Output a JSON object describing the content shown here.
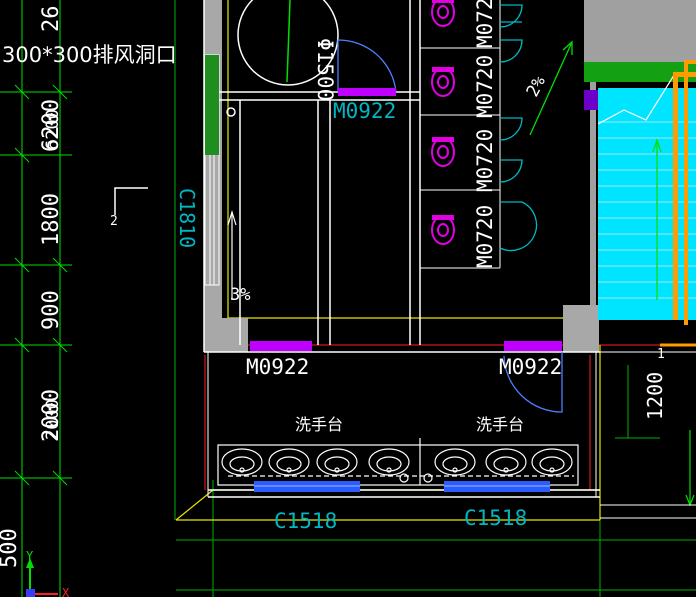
{
  "colors": {
    "background": "#000000",
    "wall_white": "#ffffff",
    "wall_gray": "#a8a8a8",
    "dim_green": "#00e000",
    "window_cyan": "#00b7c3",
    "door_purple": "#c000ff",
    "fixture_magenta": "#e000e0",
    "fixture_blue": "#4d7fff",
    "outline_yellow": "#e8e800",
    "axis_red": "#ff2020",
    "stair_fill": "#00e5ff",
    "rail_orange": "#ff9a00"
  },
  "dimensions_left": [
    "26",
    "6200",
    "1800",
    "900",
    "2000",
    "500"
  ],
  "dimension_overlay_left": [
    "6200",
    "2000"
  ],
  "dimension_right": "1200",
  "vent_note": "300*300排风洞口",
  "window_labels": [
    "C1810",
    "C1518",
    "C1518"
  ],
  "door_labels": [
    "M0922",
    "M0922",
    "M0922"
  ],
  "partition_labels": [
    "M0720",
    "M0720",
    "M0720",
    "M0720"
  ],
  "pipe_label": "Φ1500",
  "slope_labels": [
    "3%",
    "2%"
  ],
  "basin_labels": [
    "洗手台",
    "洗手台"
  ],
  "grid_marks": [
    "2",
    "1"
  ],
  "ucs": {
    "y_label": "Y",
    "x_label": "X"
  },
  "icons": [
    "ucs-axis-icon",
    "section-mark-icon",
    "slope-arrow-icon",
    "stair-up-arrow-icon"
  ]
}
